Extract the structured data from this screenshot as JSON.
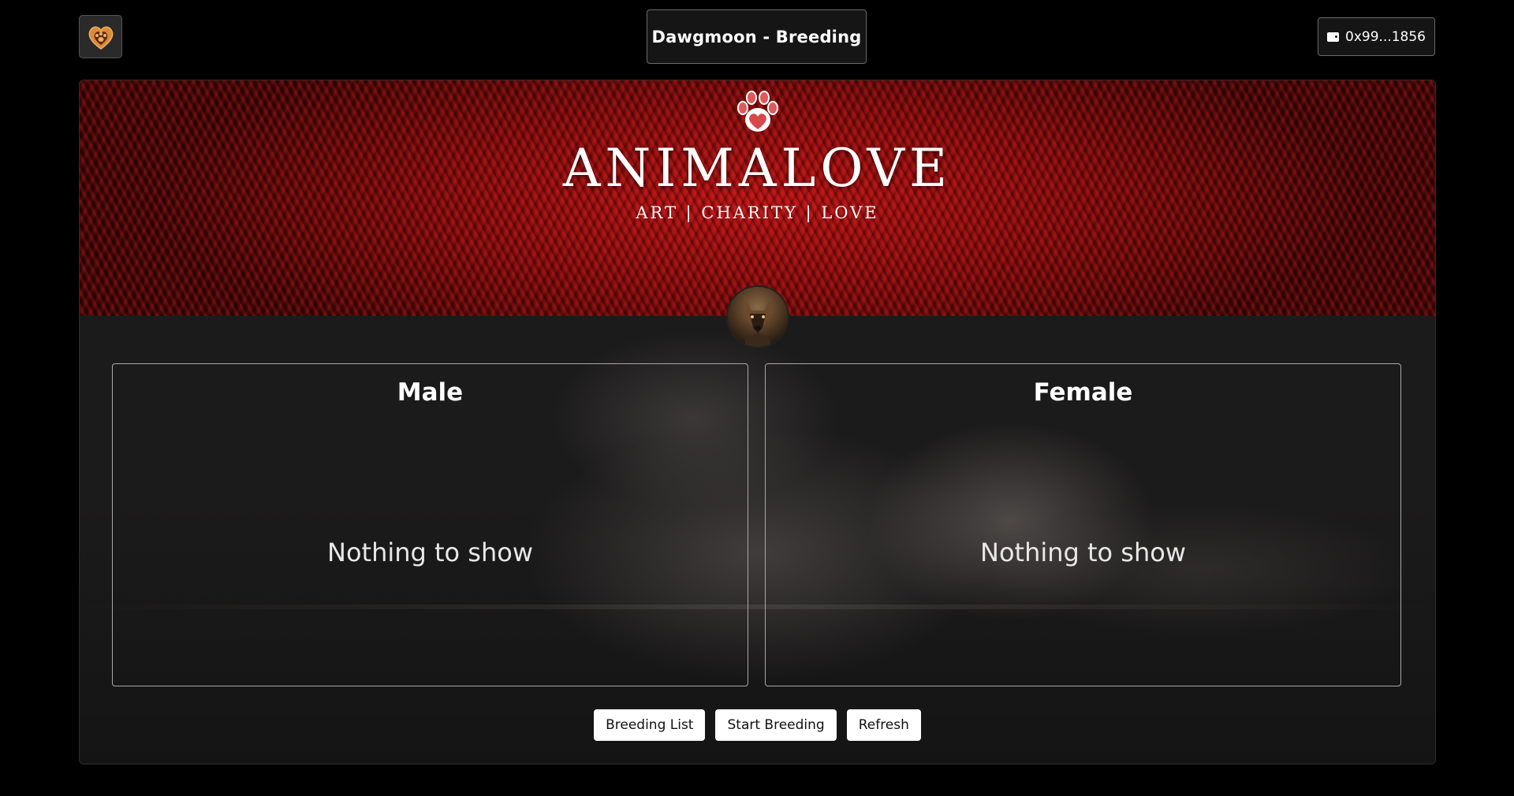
{
  "header": {
    "logo_icon": "heart-paw-icon",
    "title": "Dawgmoon - Breeding",
    "wallet": {
      "icon": "wallet-icon",
      "address": "0x99...1856"
    }
  },
  "banner": {
    "brand": "ANIMALOVE",
    "tagline": "ART | CHARITY | LOVE",
    "paw_icon": "paw-heart-icon"
  },
  "panels": {
    "male": {
      "title": "Male",
      "empty_text": "Nothing to show"
    },
    "female": {
      "title": "Female",
      "empty_text": "Nothing to show"
    }
  },
  "actions": {
    "breeding_list": "Breeding List",
    "start_breeding": "Start Breeding",
    "refresh": "Refresh"
  },
  "colors": {
    "accent_red": "#b01010",
    "background": "#000000",
    "card": "#1c1b1b"
  }
}
